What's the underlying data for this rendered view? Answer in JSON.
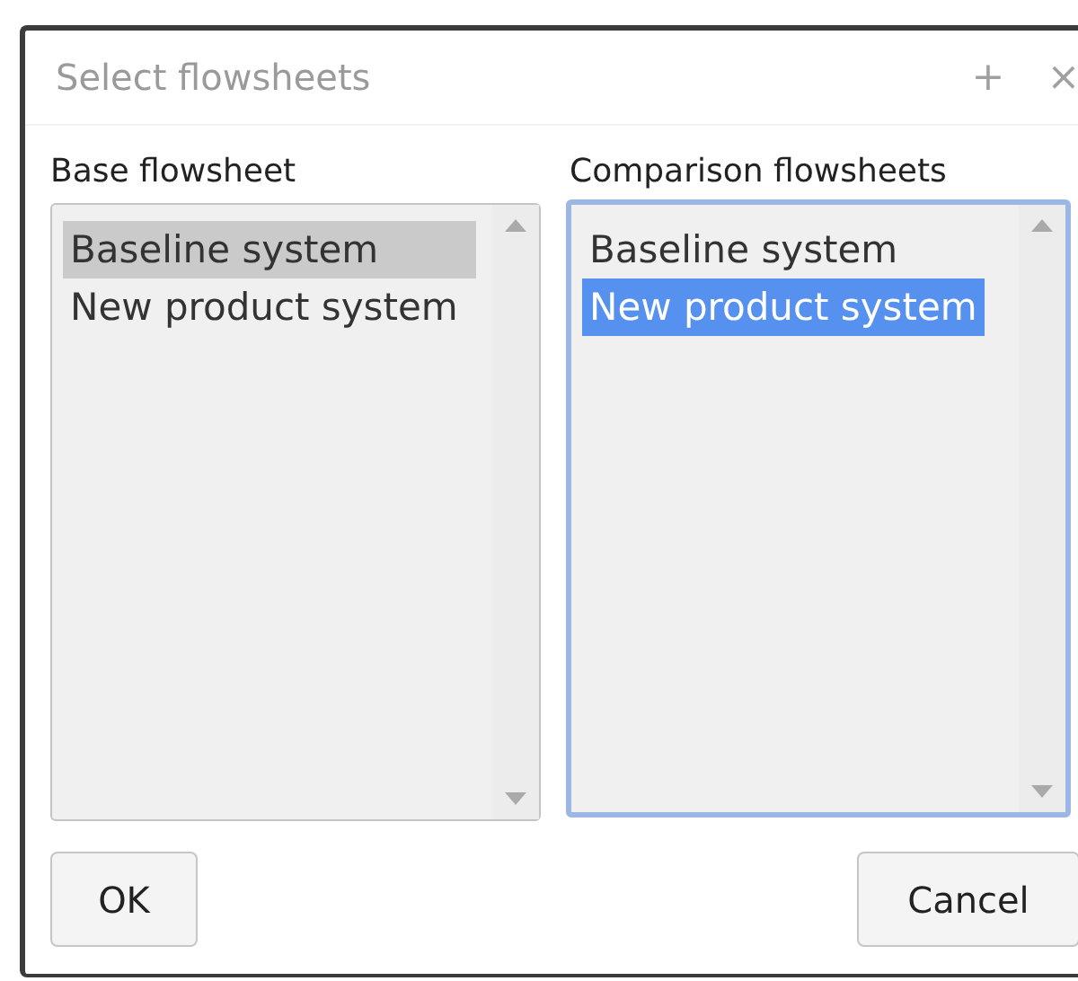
{
  "window": {
    "title": "Select flowsheets",
    "buttons": [
      "+",
      "×"
    ]
  },
  "lists": [
    {
      "label": "Base flowsheet",
      "focused": false,
      "items": [
        {
          "label": "Baseline system",
          "selected": true
        },
        {
          "label": "New product system",
          "selected": false
        }
      ]
    },
    {
      "label": "Comparison flowsheets",
      "focused": true,
      "items": [
        {
          "label": "Baseline system",
          "selected": false
        },
        {
          "label": "New product system",
          "selected": true
        }
      ]
    }
  ],
  "buttons": [
    "OK",
    "Cancel"
  ]
}
